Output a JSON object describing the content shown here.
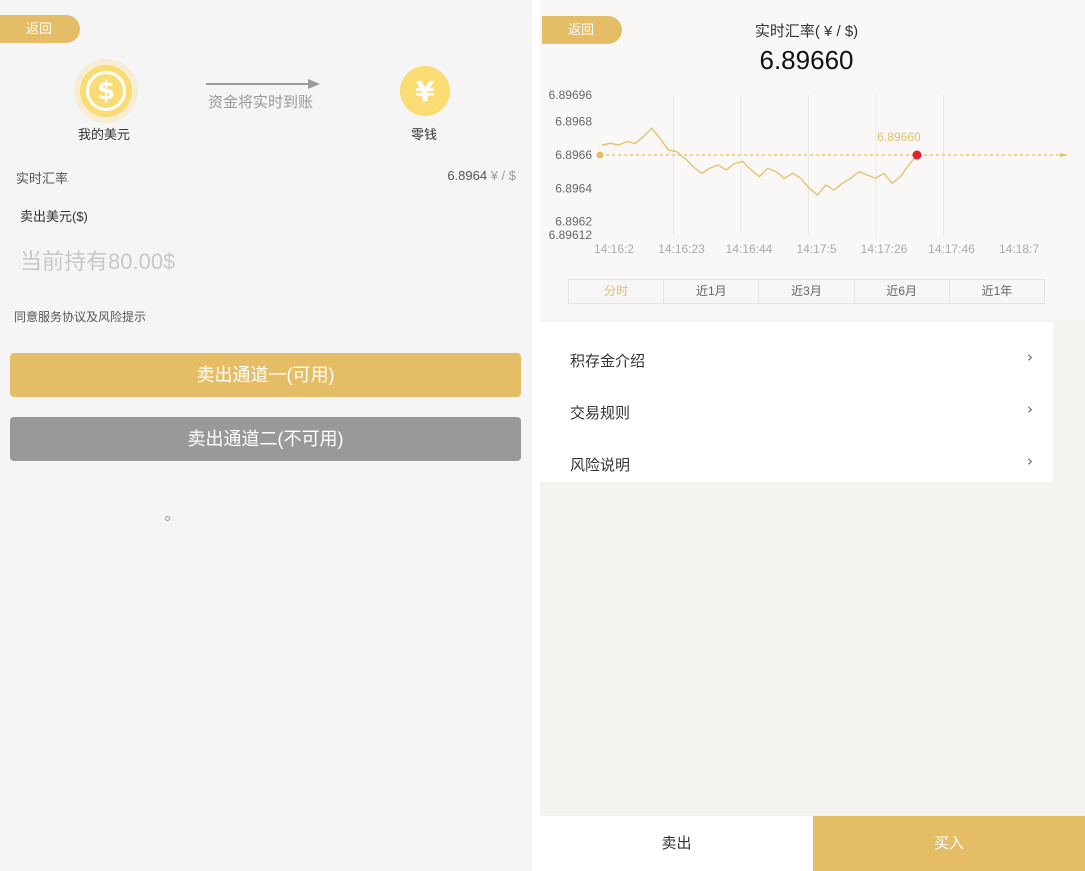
{
  "left": {
    "back_label": "返回",
    "usd_icon_glyph": "$",
    "usd_label": "我的美元",
    "cny_icon_glyph": "¥",
    "cny_label": "零钱",
    "transfer_text": "资金将实时到账",
    "rate_label": "实时汇率",
    "rate_value": "6.8964",
    "rate_unit": "¥ / $",
    "sell_label": "卖出美元($)",
    "amount_placeholder": "当前持有80.00$",
    "agreement_text": "同意服务协议及风险提示",
    "channel1_label": "卖出通道一(可用)",
    "channel2_label": "卖出通道二(不可用)"
  },
  "right": {
    "back_label": "返回",
    "rate_title": "实时汇率( ¥ / $)",
    "rate_value": "6.89660",
    "tabs": [
      "分时",
      "近1月",
      "近3月",
      "近6月",
      "近1年"
    ],
    "active_tab": "分时",
    "menu": [
      {
        "label": "积存金介绍",
        "chevron": "›"
      },
      {
        "label": "交易规则",
        "chevron": "›"
      },
      {
        "label": "风险说明",
        "chevron": "›"
      }
    ],
    "footer_sell": "卖出",
    "footer_buy": "买入"
  },
  "colors": {
    "accent": "#e6bd67",
    "disabled": "#999999",
    "marker": "#e3212f"
  },
  "chart_data": {
    "type": "line",
    "yticks": [
      "6.89696",
      "6.8968",
      "6.8966",
      "6.8964",
      "6.8962",
      "6.89612"
    ],
    "ytick_values": [
      6.89696,
      6.8968,
      6.8966,
      6.8964,
      6.8962,
      6.89612
    ],
    "ylim": [
      6.89612,
      6.89696
    ],
    "xticks": [
      "14:16:2",
      "14:16:23",
      "14:16:44",
      "14:17:5",
      "14:17:26",
      "14:17:46",
      "14:18:7"
    ],
    "current_label": "6.89660",
    "current_value": 6.8966,
    "series": [
      {
        "values": [
          6.89666,
          6.89667,
          6.89666,
          6.89668,
          6.89667,
          6.89671,
          6.89676,
          6.8967,
          6.89663,
          6.89662,
          6.89658,
          6.89653,
          6.89649,
          6.89652,
          6.89654,
          6.89651,
          6.89655,
          6.89656,
          6.89651,
          6.89647,
          6.89652,
          6.8965,
          6.89646,
          6.89649,
          6.89646,
          6.8964,
          6.89636,
          6.89642,
          6.89639,
          6.89643,
          6.89646,
          6.8965,
          6.89648,
          6.89646,
          6.89649,
          6.89643,
          6.89647,
          6.89654,
          6.8966
        ]
      }
    ]
  }
}
